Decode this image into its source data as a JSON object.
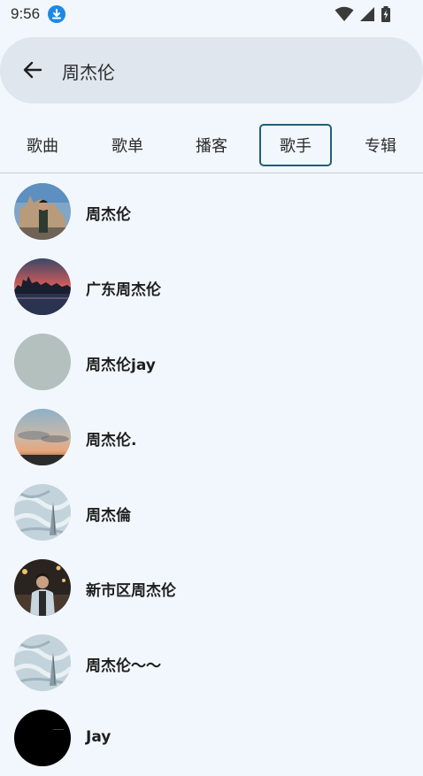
{
  "status": {
    "time": "9:56",
    "download_icon": "download-icon",
    "wifi_icon": "wifi-icon",
    "signal_icon": "signal-icon",
    "battery_icon": "battery-charging-icon"
  },
  "search": {
    "query": "周杰伦",
    "back_icon": "arrow-left-icon"
  },
  "tabs": [
    {
      "label": "歌曲",
      "active": false
    },
    {
      "label": "歌单",
      "active": false
    },
    {
      "label": "播客",
      "active": false
    },
    {
      "label": "歌手",
      "active": true
    },
    {
      "label": "专辑",
      "active": false
    }
  ],
  "colors": {
    "background": "#f1f7fd",
    "search_bg": "#dfe6ee",
    "active_tab_border": "#1f5f7a"
  },
  "artists": [
    {
      "name": "周杰伦",
      "avatar": "photo-person-castle"
    },
    {
      "name": "广东周杰伦",
      "avatar": "photo-city-sunset"
    },
    {
      "name": "周杰伦jay",
      "avatar": "placeholder-gray"
    },
    {
      "name": "周杰伦.",
      "avatar": "photo-sky-sunset"
    },
    {
      "name": "周杰倫",
      "avatar": "photo-water-tower"
    },
    {
      "name": "新市区周杰伦",
      "avatar": "photo-person-stage"
    },
    {
      "name": "周杰伦～～",
      "avatar": "photo-water-tower"
    },
    {
      "name": "Jay",
      "avatar": "photo-black"
    }
  ]
}
